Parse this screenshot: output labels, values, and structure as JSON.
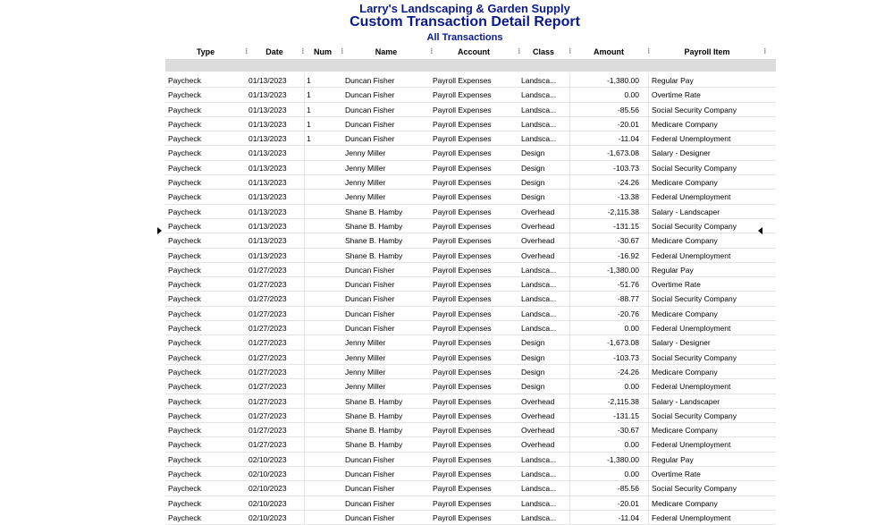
{
  "report": {
    "company": "Larry's Landscaping & Garden Supply",
    "title": "Custom Transaction Detail Report",
    "subtitle": "All Transactions"
  },
  "columns": [
    "Type",
    "Date",
    "Num",
    "Name",
    "Account",
    "Class",
    "Amount",
    "Payroll Item"
  ],
  "rows": [
    [
      "Paycheck",
      "01/13/2023",
      "1",
      "Duncan Fisher",
      "Payroll Expenses",
      "Landsca...",
      "-1,380.00",
      "Regular Pay"
    ],
    [
      "Paycheck",
      "01/13/2023",
      "1",
      "Duncan Fisher",
      "Payroll Expenses",
      "Landsca...",
      "0.00",
      "Overtime Rate"
    ],
    [
      "Paycheck",
      "01/13/2023",
      "1",
      "Duncan Fisher",
      "Payroll Expenses",
      "Landsca...",
      "-85.56",
      "Social Security Company"
    ],
    [
      "Paycheck",
      "01/13/2023",
      "1",
      "Duncan Fisher",
      "Payroll Expenses",
      "Landsca...",
      "-20.01",
      "Medicare Company"
    ],
    [
      "Paycheck",
      "01/13/2023",
      "1",
      "Duncan Fisher",
      "Payroll Expenses",
      "Landsca...",
      "-11.04",
      "Federal Unemployment"
    ],
    [
      "Paycheck",
      "01/13/2023",
      "",
      "Jenny Miller",
      "Payroll Expenses",
      "Design",
      "-1,673.08",
      "Salary - Designer"
    ],
    [
      "Paycheck",
      "01/13/2023",
      "",
      "Jenny Miller",
      "Payroll Expenses",
      "Design",
      "-103.73",
      "Social Security Company"
    ],
    [
      "Paycheck",
      "01/13/2023",
      "",
      "Jenny Miller",
      "Payroll Expenses",
      "Design",
      "-24.26",
      "Medicare Company"
    ],
    [
      "Paycheck",
      "01/13/2023",
      "",
      "Jenny Miller",
      "Payroll Expenses",
      "Design",
      "-13.38",
      "Federal Unemployment"
    ],
    [
      "Paycheck",
      "01/13/2023",
      "",
      "Shane B. Hamby",
      "Payroll Expenses",
      "Overhead",
      "-2,115.38",
      "Salary - Landscaper"
    ],
    [
      "Paycheck",
      "01/13/2023",
      "",
      "Shane B. Hamby",
      "Payroll Expenses",
      "Overhead",
      "-131.15",
      "Social Security Company"
    ],
    [
      "Paycheck",
      "01/13/2023",
      "",
      "Shane B. Hamby",
      "Payroll Expenses",
      "Overhead",
      "-30.67",
      "Medicare Company"
    ],
    [
      "Paycheck",
      "01/13/2023",
      "",
      "Shane B. Hamby",
      "Payroll Expenses",
      "Overhead",
      "-16.92",
      "Federal Unemployment"
    ],
    [
      "Paycheck",
      "01/27/2023",
      "",
      "Duncan Fisher",
      "Payroll Expenses",
      "Landsca...",
      "-1,380.00",
      "Regular Pay"
    ],
    [
      "Paycheck",
      "01/27/2023",
      "",
      "Duncan Fisher",
      "Payroll Expenses",
      "Landsca...",
      "-51.76",
      "Overtime Rate"
    ],
    [
      "Paycheck",
      "01/27/2023",
      "",
      "Duncan Fisher",
      "Payroll Expenses",
      "Landsca...",
      "-88.77",
      "Social Security Company"
    ],
    [
      "Paycheck",
      "01/27/2023",
      "",
      "Duncan Fisher",
      "Payroll Expenses",
      "Landsca...",
      "-20.76",
      "Medicare Company"
    ],
    [
      "Paycheck",
      "01/27/2023",
      "",
      "Duncan Fisher",
      "Payroll Expenses",
      "Landsca...",
      "0.00",
      "Federal Unemployment"
    ],
    [
      "Paycheck",
      "01/27/2023",
      "",
      "Jenny Miller",
      "Payroll Expenses",
      "Design",
      "-1,673.08",
      "Salary - Designer"
    ],
    [
      "Paycheck",
      "01/27/2023",
      "",
      "Jenny Miller",
      "Payroll Expenses",
      "Design",
      "-103.73",
      "Social Security Company"
    ],
    [
      "Paycheck",
      "01/27/2023",
      "",
      "Jenny Miller",
      "Payroll Expenses",
      "Design",
      "-24.26",
      "Medicare Company"
    ],
    [
      "Paycheck",
      "01/27/2023",
      "",
      "Jenny Miller",
      "Payroll Expenses",
      "Design",
      "0.00",
      "Federal Unemployment"
    ],
    [
      "Paycheck",
      "01/27/2023",
      "",
      "Shane B. Hamby",
      "Payroll Expenses",
      "Overhead",
      "-2,115.38",
      "Salary - Landscaper"
    ],
    [
      "Paycheck",
      "01/27/2023",
      "",
      "Shane B. Hamby",
      "Payroll Expenses",
      "Overhead",
      "-131.15",
      "Social Security Company"
    ],
    [
      "Paycheck",
      "01/27/2023",
      "",
      "Shane B. Hamby",
      "Payroll Expenses",
      "Overhead",
      "-30.67",
      "Medicare Company"
    ],
    [
      "Paycheck",
      "01/27/2023",
      "",
      "Shane B. Hamby",
      "Payroll Expenses",
      "Overhead",
      "0.00",
      "Federal Unemployment"
    ],
    [
      "Paycheck",
      "02/10/2023",
      "",
      "Duncan Fisher",
      "Payroll Expenses",
      "Landsca...",
      "-1,380.00",
      "Regular Pay"
    ],
    [
      "Paycheck",
      "02/10/2023",
      "",
      "Duncan Fisher",
      "Payroll Expenses",
      "Landsca...",
      "0.00",
      "Overtime Rate"
    ],
    [
      "Paycheck",
      "02/10/2023",
      "",
      "Duncan Fisher",
      "Payroll Expenses",
      "Landsca...",
      "-85.56",
      "Social Security Company"
    ],
    [
      "Paycheck",
      "02/10/2023",
      "",
      "Duncan Fisher",
      "Payroll Expenses",
      "Landsca...",
      "-20.01",
      "Medicare Company"
    ],
    [
      "Paycheck",
      "02/10/2023",
      "",
      "Duncan Fisher",
      "Payroll Expenses",
      "Landsca...",
      "-11.04",
      "Federal Unemployment"
    ]
  ],
  "selected_row_index": 11
}
